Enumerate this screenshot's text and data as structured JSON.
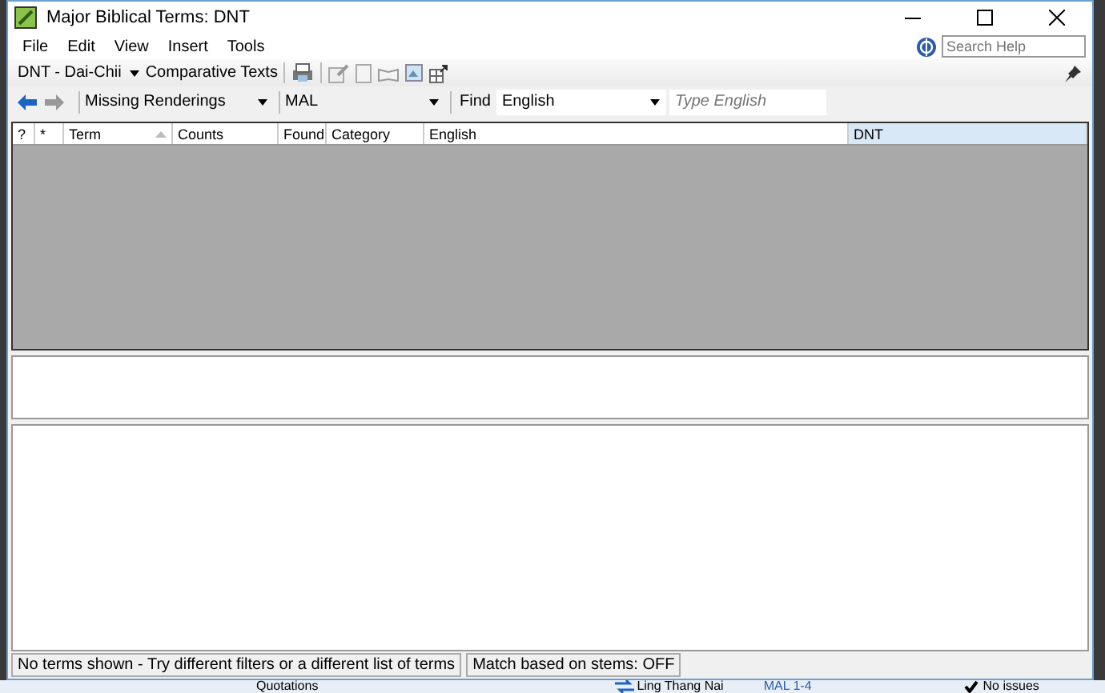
{
  "window": {
    "title": "Major Biblical Terms: DNT"
  },
  "menu": [
    "File",
    "Edit",
    "View",
    "Insert",
    "Tools"
  ],
  "help_search": {
    "placeholder": "Search Help"
  },
  "toolbar": {
    "project": "DNT - Dai-Chii",
    "comparative": "Comparative Texts"
  },
  "filter_bar": {
    "filter": "Missing Renderings",
    "book": "MAL",
    "find_label": "Find",
    "find_language": "English",
    "find_field": {
      "placeholder": "Type English"
    }
  },
  "table": {
    "columns": [
      {
        "label": "?",
        "selected": false,
        "sorted": false
      },
      {
        "label": "*",
        "selected": false,
        "sorted": false
      },
      {
        "label": "Term",
        "selected": false,
        "sorted": true
      },
      {
        "label": "Counts",
        "selected": false,
        "sorted": false
      },
      {
        "label": "Found",
        "selected": false,
        "sorted": false
      },
      {
        "label": "Category",
        "selected": false,
        "sorted": false
      },
      {
        "label": "English",
        "selected": false,
        "sorted": false
      },
      {
        "label": "DNT",
        "selected": true,
        "sorted": false
      }
    ]
  },
  "status_bar": [
    "No terms shown - Try different filters or a different list of terms",
    "Match based on stems: OFF"
  ],
  "background_app": [
    "Quotations",
    "Ling Thang Nai",
    "MAL 1-4",
    "No issues"
  ]
}
